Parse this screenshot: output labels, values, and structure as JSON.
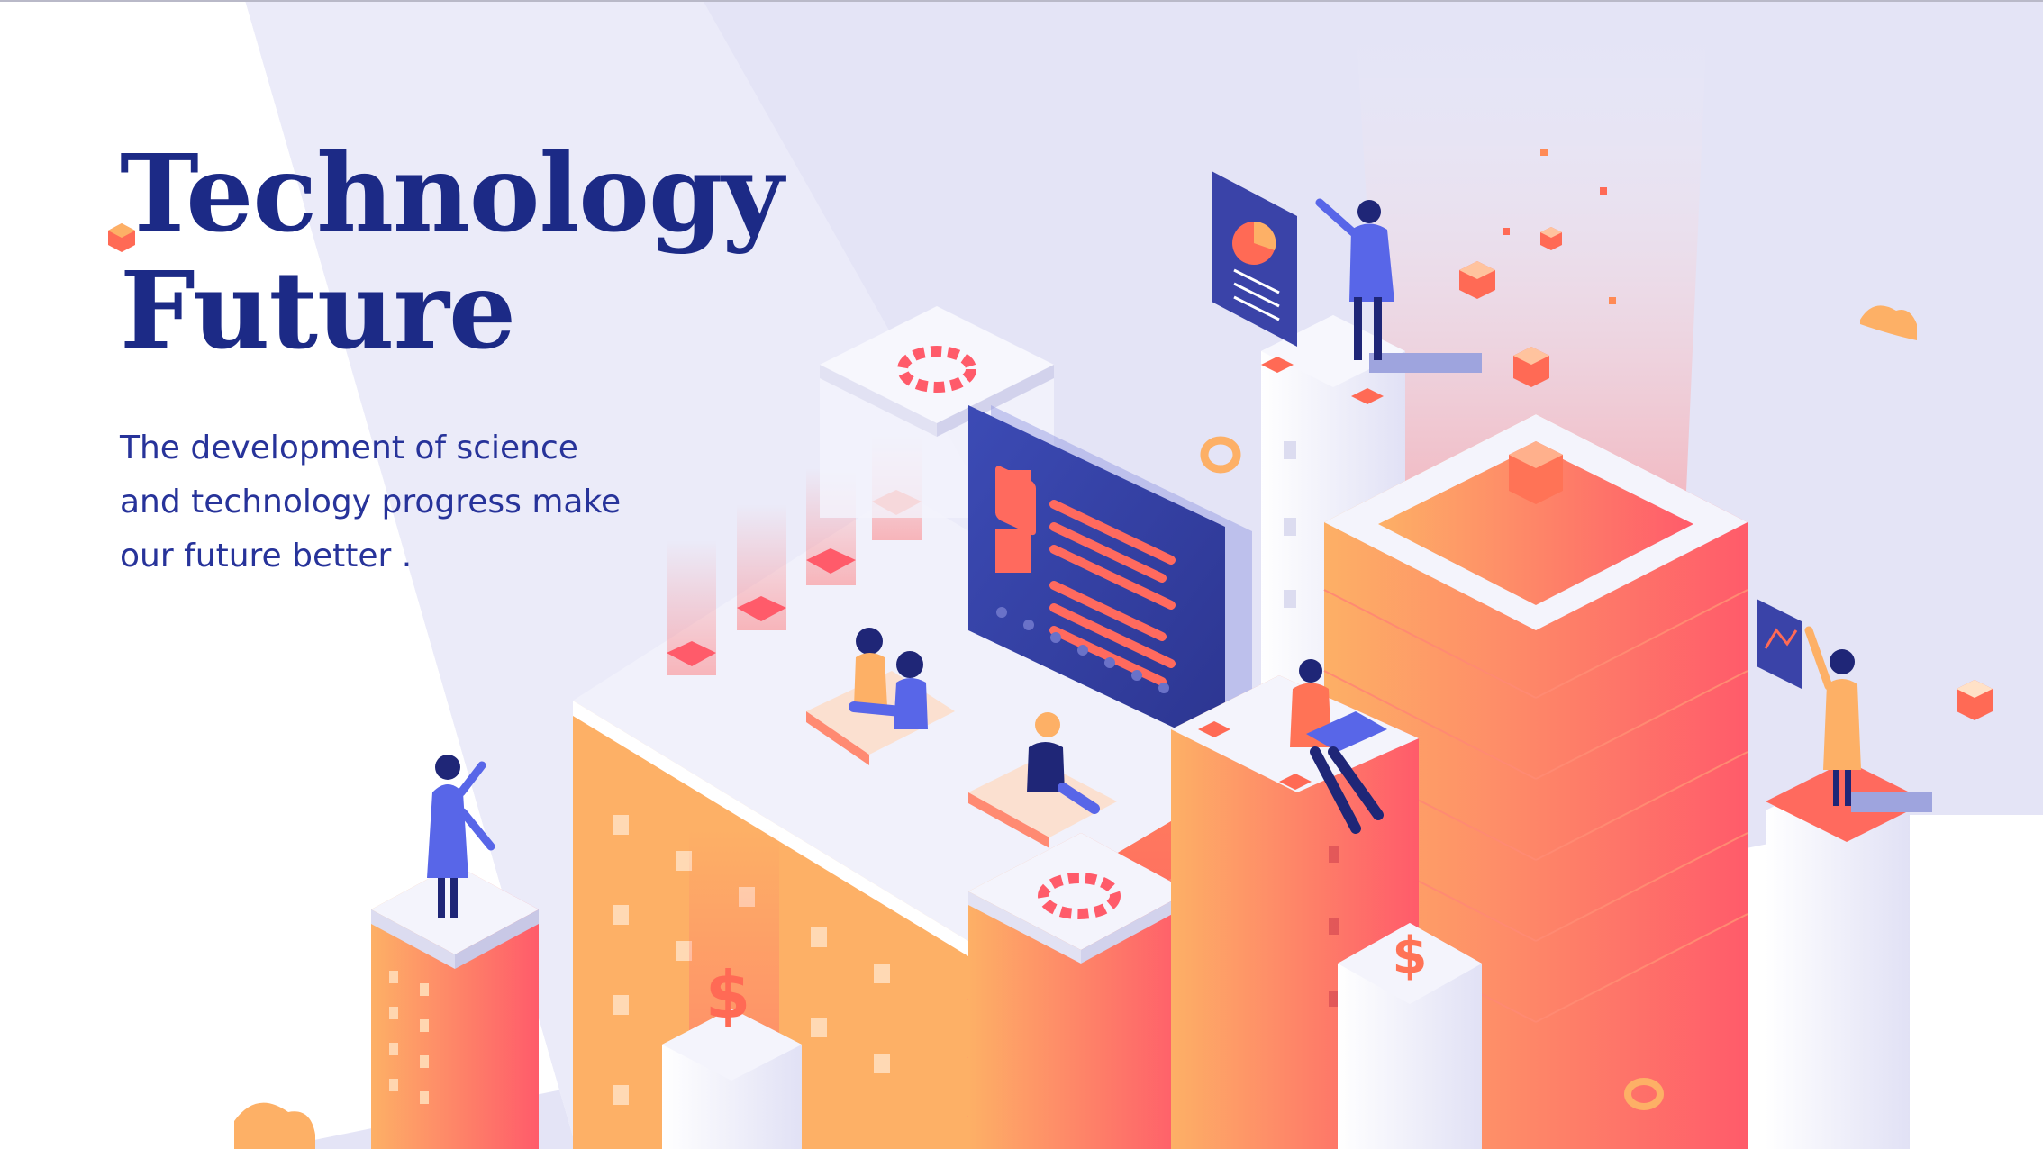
{
  "slide": {
    "title_line_1": "Technology",
    "title_line_2": "Future",
    "body_line_1": "The development of science",
    "body_line_2": "and technology progress make",
    "body_line_3": "our future better .",
    "screen_badges": [
      "$",
      "$"
    ]
  },
  "palette": {
    "title": "#1c2a86",
    "body_text": "#27339a",
    "background_wedge": "#e3e3f6",
    "orange": "#fdb066",
    "coral": "#ff5b6a",
    "white_block": "#f2f2fb",
    "screen_navy": "#3a43a8"
  }
}
